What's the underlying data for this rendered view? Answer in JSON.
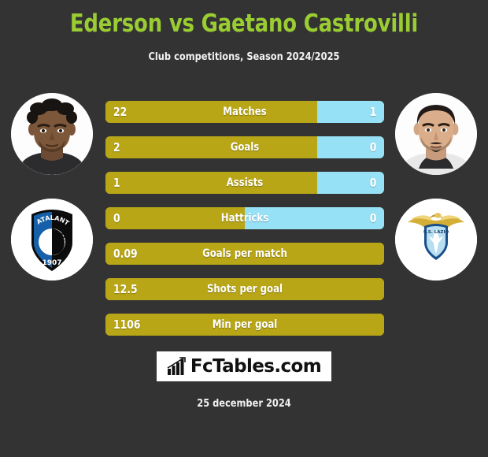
{
  "header": {
    "title": "Ederson vs Gaetano Castrovilli",
    "subtitle": "Club competitions, Season 2024/2025",
    "title_color": "#9acd32"
  },
  "players": {
    "home": {
      "name": "Ederson",
      "photo_icon": "player-photo",
      "club": "Atalanta",
      "club_badge_icon": "atalanta-crest",
      "club_badge_year": "1907",
      "club_badge_text": "ATALANTA"
    },
    "away": {
      "name": "Gaetano Castrovilli",
      "photo_icon": "player-photo",
      "club": "Lazio",
      "club_badge_icon": "lazio-crest",
      "club_badge_text": "S.S. LAZIO"
    }
  },
  "colors": {
    "background": "#333333",
    "home_bar": "#b8a617",
    "away_bar": "#96e1f6",
    "bar_outline": "#e6e1aa",
    "text": "#ffffff"
  },
  "stats": [
    {
      "label": "Matches",
      "home": "22",
      "away": "1",
      "home_pct": 76,
      "away_pct": 24,
      "split": true
    },
    {
      "label": "Goals",
      "home": "2",
      "away": "0",
      "home_pct": 76,
      "away_pct": 24,
      "split": true
    },
    {
      "label": "Assists",
      "home": "1",
      "away": "0",
      "home_pct": 76,
      "away_pct": 24,
      "split": true
    },
    {
      "label": "Hattricks",
      "home": "0",
      "away": "0",
      "home_pct": 50,
      "away_pct": 50,
      "split": true
    },
    {
      "label": "Goals per match",
      "home": "0.09",
      "away": "",
      "home_pct": 100,
      "away_pct": 0,
      "split": false
    },
    {
      "label": "Shots per goal",
      "home": "12.5",
      "away": "",
      "home_pct": 100,
      "away_pct": 0,
      "split": false
    },
    {
      "label": "Min per goal",
      "home": "1106",
      "away": "",
      "home_pct": 100,
      "away_pct": 0,
      "split": false
    }
  ],
  "footer": {
    "logo_text": "FcTables.com",
    "logo_icon": "bar-chart-growth-icon",
    "date": "25 december 2024"
  }
}
